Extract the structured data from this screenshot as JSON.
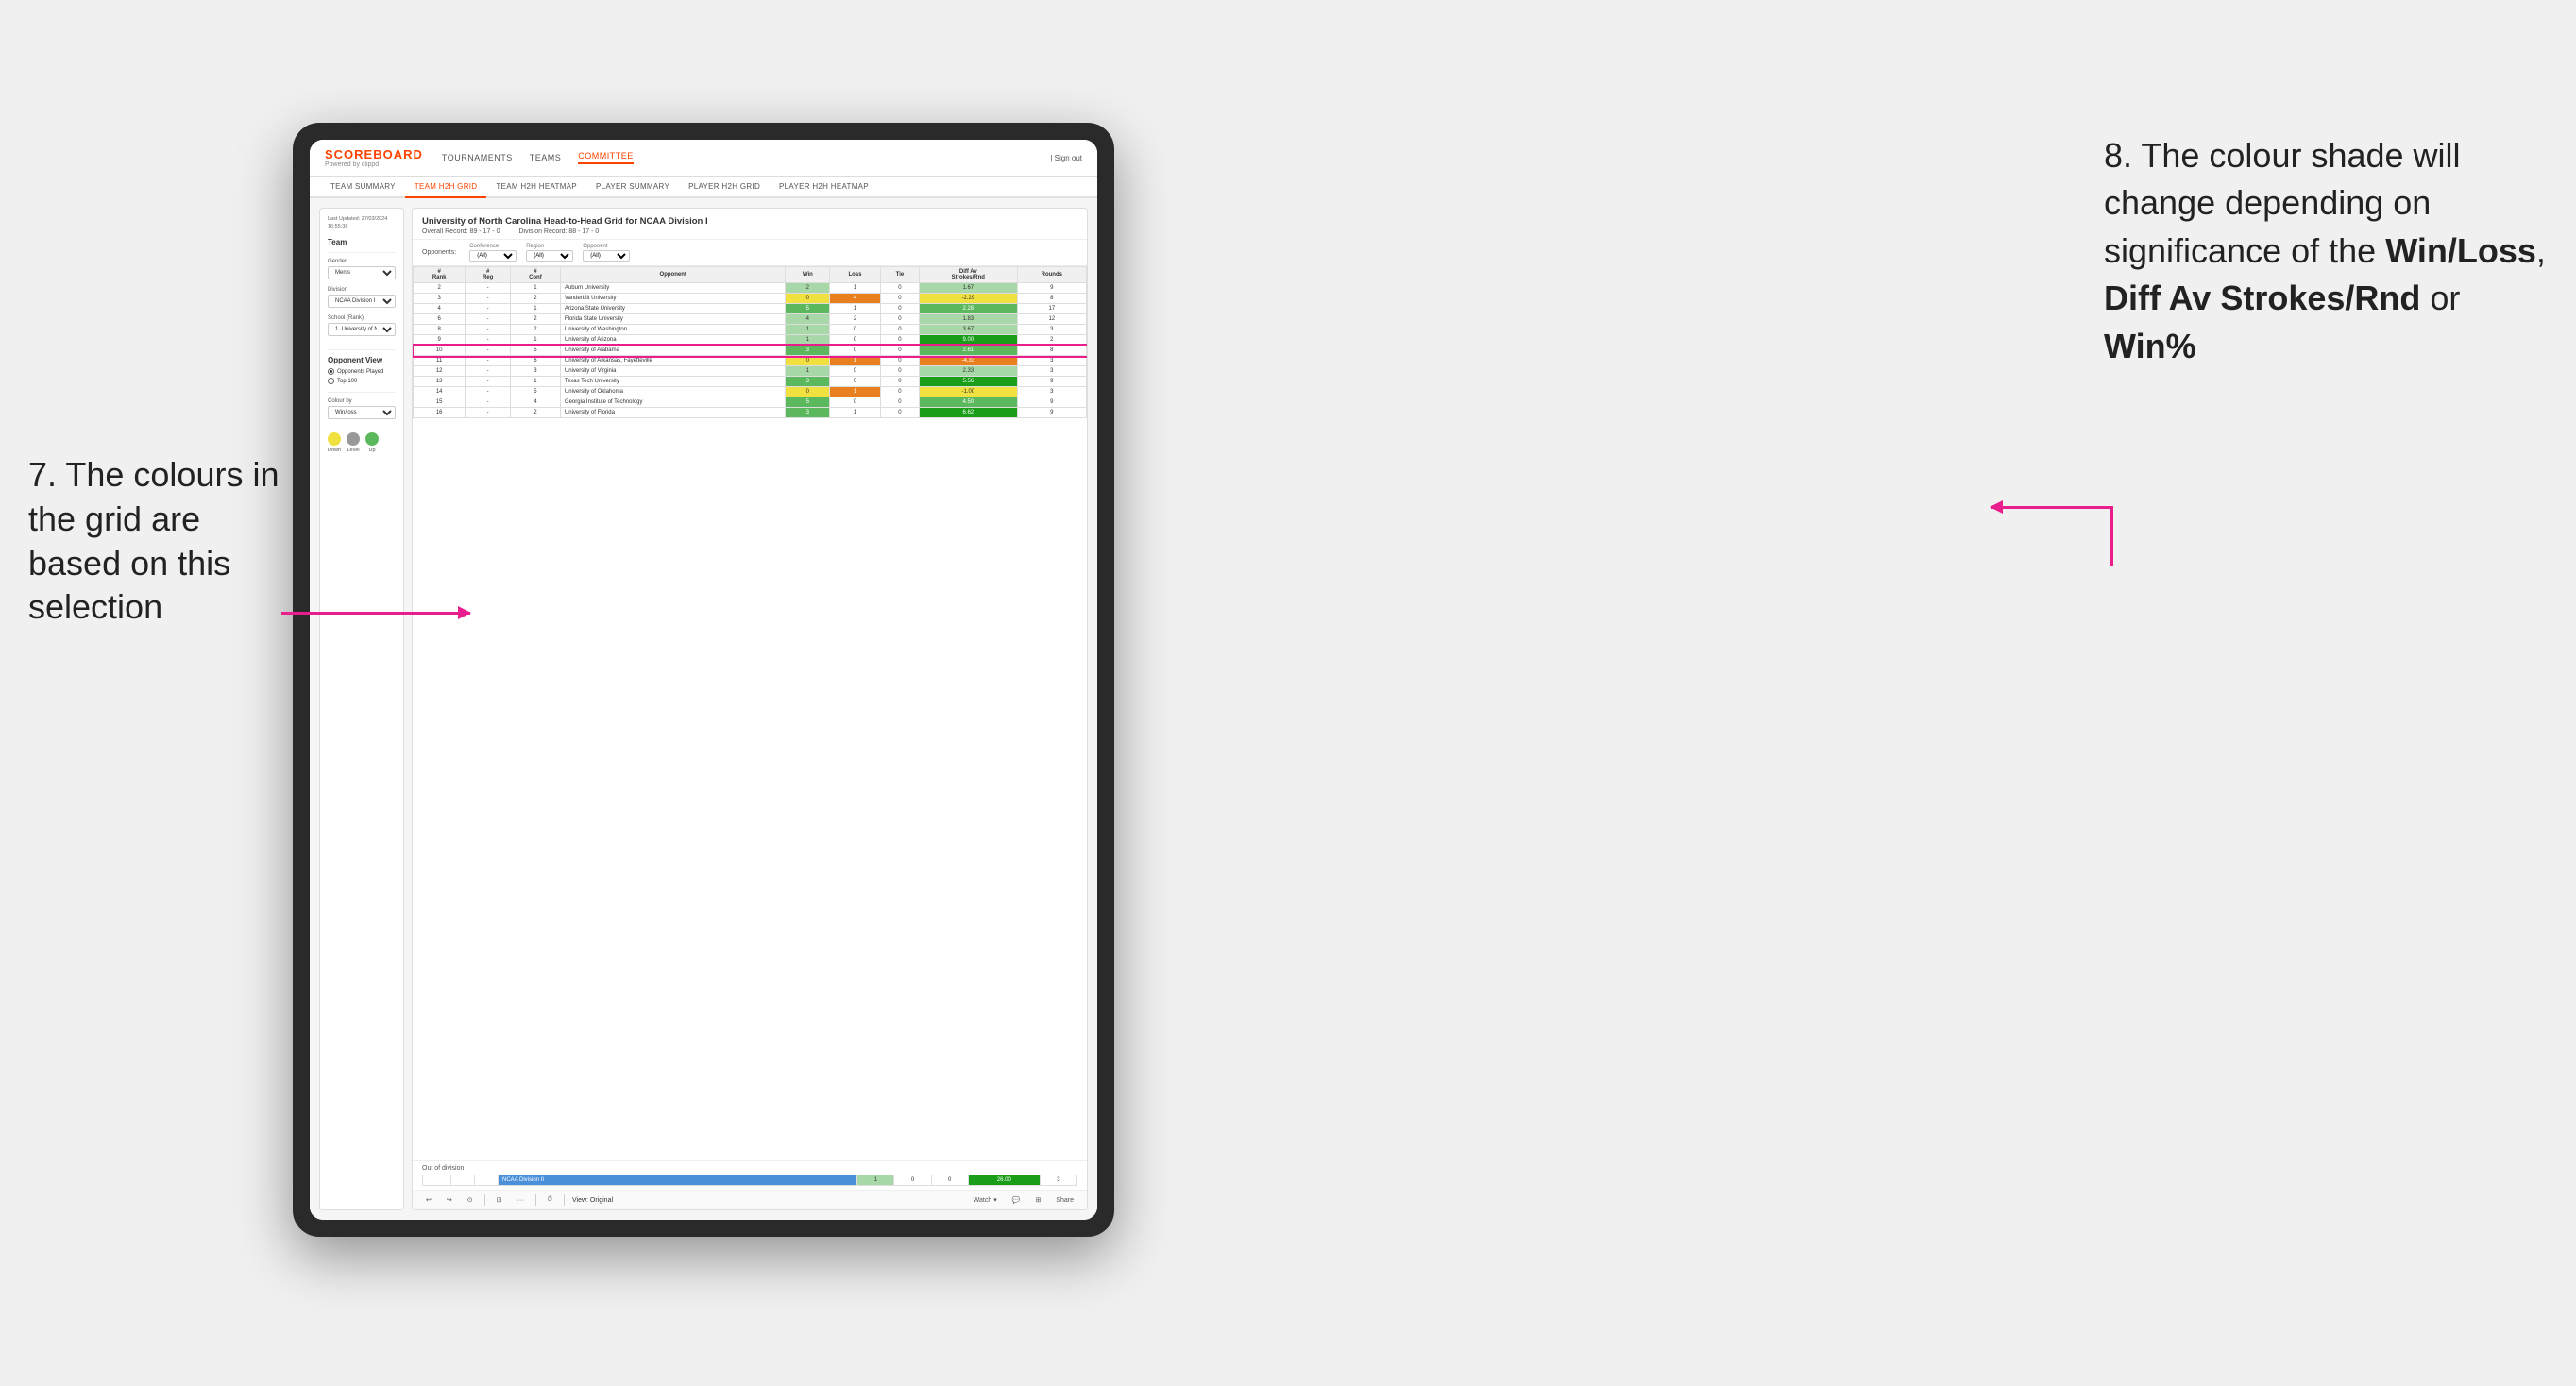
{
  "annotations": {
    "left": {
      "text": "7. The colours in the grid are based on this selection"
    },
    "right": {
      "intro": "8. The colour shade will change depending on significance of the ",
      "bold1": "Win/Loss",
      "sep1": ", ",
      "bold2": "Diff Av Strokes/Rnd",
      "sep2": " or ",
      "bold3": "Win%"
    }
  },
  "header": {
    "logo": "SCOREBOARD",
    "logo_sub": "Powered by clippd",
    "nav": [
      "TOURNAMENTS",
      "TEAMS",
      "COMMITTEE"
    ],
    "active_nav": "COMMITTEE",
    "sign_out": "Sign out"
  },
  "sub_nav": {
    "items": [
      "TEAM SUMMARY",
      "TEAM H2H GRID",
      "TEAM H2H HEATMAP",
      "PLAYER SUMMARY",
      "PLAYER H2H GRID",
      "PLAYER H2H HEATMAP"
    ],
    "active": "TEAM H2H GRID"
  },
  "sidebar": {
    "timestamp": "Last Updated: 27/03/2024\n16:55:38",
    "team_label": "Team",
    "gender_label": "Gender",
    "gender_value": "Men's",
    "division_label": "Division",
    "division_value": "NCAA Division I",
    "school_label": "School (Rank)",
    "school_value": "1. University of Nort...",
    "opponent_view_label": "Opponent View",
    "opponents_played": "Opponents Played",
    "top100": "Top 100",
    "colour_by_label": "Colour by",
    "colour_by_value": "Win/loss",
    "legend": {
      "down": "Down",
      "level": "Level",
      "up": "Up"
    }
  },
  "grid": {
    "title": "University of North Carolina Head-to-Head Grid for NCAA Division I",
    "overall_record": "Overall Record: 89 - 17 - 0",
    "division_record": "Division Record: 88 - 17 - 0",
    "filters": {
      "opponents_label": "Opponents:",
      "conference_label": "Conference",
      "conference_value": "(All)",
      "region_label": "Region",
      "region_value": "(All)",
      "opponent_label": "Opponent",
      "opponent_value": "(All)"
    },
    "columns": [
      "#\nRank",
      "#\nReg",
      "#\nConf",
      "Opponent",
      "Win",
      "Loss",
      "Tie",
      "Diff Av\nStrokes/Rnd",
      "Rounds"
    ],
    "rows": [
      {
        "rank": "2",
        "reg": "-",
        "conf": "1",
        "opponent": "Auburn University",
        "win": "2",
        "loss": "1",
        "tie": "0",
        "diff": "1.67",
        "rounds": "9",
        "win_color": "green-light",
        "loss_color": "neutral",
        "diff_color": "green-light"
      },
      {
        "rank": "3",
        "reg": "-",
        "conf": "2",
        "opponent": "Vanderbilt University",
        "win": "0",
        "loss": "4",
        "tie": "0",
        "diff": "-2.29",
        "rounds": "8",
        "win_color": "yellow",
        "loss_color": "orange",
        "diff_color": "yellow"
      },
      {
        "rank": "4",
        "reg": "-",
        "conf": "1",
        "opponent": "Arizona State University",
        "win": "5",
        "loss": "1",
        "tie": "0",
        "diff": "2.28",
        "rounds": "17",
        "win_color": "green",
        "loss_color": "neutral",
        "diff_color": "green"
      },
      {
        "rank": "6",
        "reg": "-",
        "conf": "2",
        "opponent": "Florida State University",
        "win": "4",
        "loss": "2",
        "tie": "0",
        "diff": "1.83",
        "rounds": "12",
        "win_color": "green-light",
        "loss_color": "neutral",
        "diff_color": "green-light"
      },
      {
        "rank": "8",
        "reg": "-",
        "conf": "2",
        "opponent": "University of Washington",
        "win": "1",
        "loss": "0",
        "tie": "0",
        "diff": "3.67",
        "rounds": "3",
        "win_color": "green-light",
        "loss_color": "neutral",
        "diff_color": "green-light"
      },
      {
        "rank": "9",
        "reg": "-",
        "conf": "1",
        "opponent": "University of Arizona",
        "win": "1",
        "loss": "0",
        "tie": "0",
        "diff": "9.00",
        "rounds": "2",
        "win_color": "green-light",
        "loss_color": "neutral",
        "diff_color": "green-dark"
      },
      {
        "rank": "10",
        "reg": "-",
        "conf": "5",
        "opponent": "University of Alabama",
        "win": "3",
        "loss": "0",
        "tie": "0",
        "diff": "2.61",
        "rounds": "8",
        "win_color": "green",
        "loss_color": "neutral",
        "diff_color": "green",
        "highlighted": true
      },
      {
        "rank": "11",
        "reg": "-",
        "conf": "6",
        "opponent": "University of Arkansas, Fayetteville",
        "win": "0",
        "loss": "1",
        "tie": "0",
        "diff": "-4.33",
        "rounds": "3",
        "win_color": "yellow",
        "loss_color": "orange",
        "diff_color": "orange"
      },
      {
        "rank": "12",
        "reg": "-",
        "conf": "3",
        "opponent": "University of Virginia",
        "win": "1",
        "loss": "0",
        "tie": "0",
        "diff": "2.33",
        "rounds": "3",
        "win_color": "green-light",
        "loss_color": "neutral",
        "diff_color": "green-light"
      },
      {
        "rank": "13",
        "reg": "-",
        "conf": "1",
        "opponent": "Texas Tech University",
        "win": "3",
        "loss": "0",
        "tie": "0",
        "diff": "5.56",
        "rounds": "9",
        "win_color": "green",
        "loss_color": "neutral",
        "diff_color": "green-dark"
      },
      {
        "rank": "14",
        "reg": "-",
        "conf": "5",
        "opponent": "University of Oklahoma",
        "win": "0",
        "loss": "1",
        "tie": "0",
        "diff": "-1.00",
        "rounds": "3",
        "win_color": "yellow",
        "loss_color": "orange",
        "diff_color": "yellow"
      },
      {
        "rank": "15",
        "reg": "-",
        "conf": "4",
        "opponent": "Georgia Institute of Technology",
        "win": "5",
        "loss": "0",
        "tie": "0",
        "diff": "4.50",
        "rounds": "9",
        "win_color": "green",
        "loss_color": "neutral",
        "diff_color": "green"
      },
      {
        "rank": "16",
        "reg": "-",
        "conf": "2",
        "opponent": "University of Florida",
        "win": "3",
        "loss": "1",
        "tie": "0",
        "diff": "6.62",
        "rounds": "9",
        "win_color": "green",
        "loss_color": "neutral",
        "diff_color": "green-dark"
      }
    ],
    "out_of_division": {
      "title": "Out of division",
      "row": {
        "division": "NCAA Division II",
        "win": "1",
        "loss": "0",
        "tie": "0",
        "diff": "26.00",
        "rounds": "3",
        "win_color": "green-light",
        "diff_color": "green-dark"
      }
    }
  },
  "toolbar": {
    "undo": "↩",
    "redo": "↪",
    "history": "⊙",
    "camera": "⊡",
    "dots": "···",
    "clock": "⏱",
    "view": "View: Original",
    "watch": "Watch ▾",
    "comment": "💬",
    "grid": "⊞",
    "share": "Share"
  }
}
